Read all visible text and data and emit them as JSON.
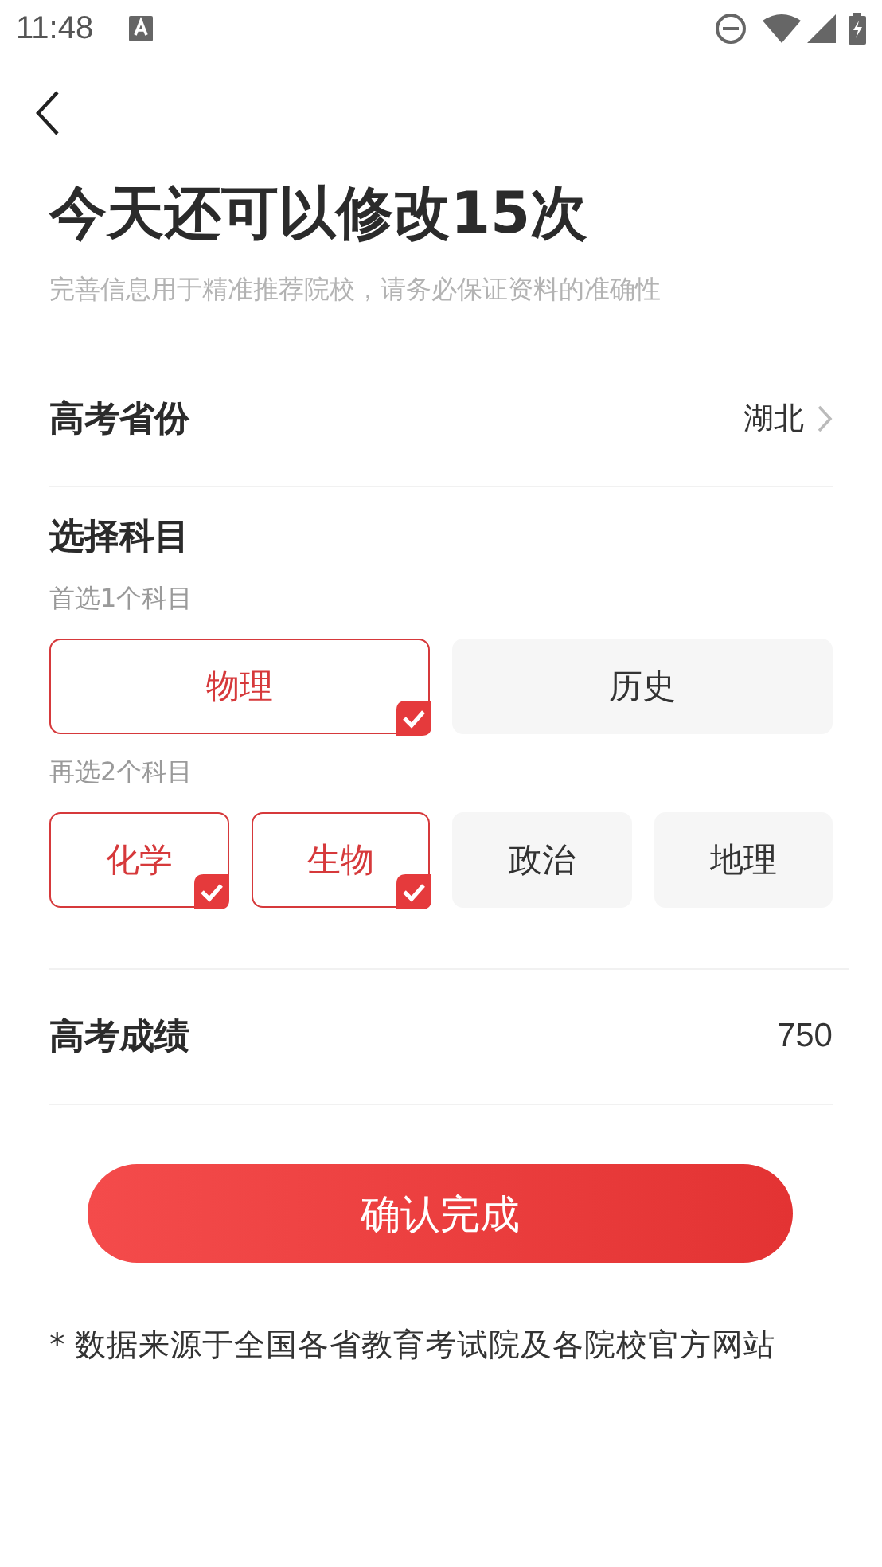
{
  "status_bar": {
    "time": "11:48"
  },
  "title": "今天还可以修改15次",
  "subtitle": "完善信息用于精准推荐院校，请务必保证资料的准确性",
  "province": {
    "label": "高考省份",
    "value": "湖北"
  },
  "subjects": {
    "heading": "选择科目",
    "groups": [
      {
        "label": "首选1个科目",
        "options": [
          {
            "label": "物理",
            "selected": true
          },
          {
            "label": "历史",
            "selected": false
          }
        ]
      },
      {
        "label": "再选2个科目",
        "options": [
          {
            "label": "化学",
            "selected": true
          },
          {
            "label": "生物",
            "selected": true
          },
          {
            "label": "政治",
            "selected": false
          },
          {
            "label": "地理",
            "selected": false
          }
        ]
      }
    ]
  },
  "score": {
    "label": "高考成绩",
    "value": "750"
  },
  "confirm_button": "确认完成",
  "footnote": "* 数据来源于全国各省教育考试院及各院校官方网站"
}
